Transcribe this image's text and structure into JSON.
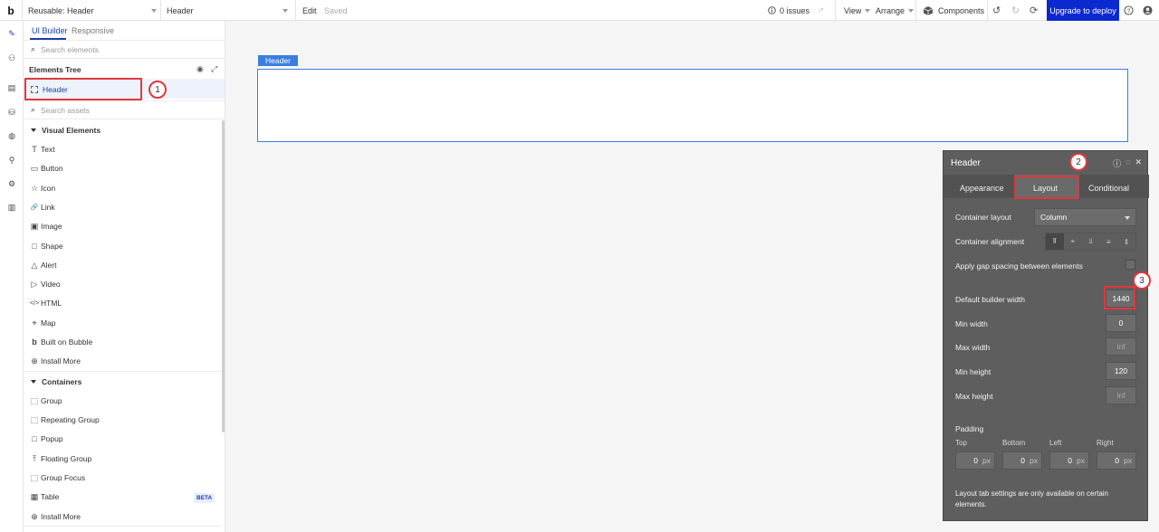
{
  "topbar": {
    "logo": "b",
    "page_selector": "Reusable: Header",
    "element_selector": "Header",
    "edit": "Edit",
    "saved": "Saved",
    "issues": "0 issues",
    "view": "View",
    "arrange": "Arrange",
    "components": "Components",
    "upgrade": "Upgrade to deploy"
  },
  "panel": {
    "tabs": [
      "UI Builder",
      "Responsive"
    ],
    "search_elements": "Search elements",
    "elements_tree": "Elements Tree",
    "tree_item": "Header",
    "search_assets": "Search assets",
    "visual_elements_title": "Visual Elements",
    "visual_elements": [
      {
        "label": "Text",
        "icon": "T"
      },
      {
        "label": "Button",
        "icon": "▭"
      },
      {
        "label": "Icon",
        "icon": "☆"
      },
      {
        "label": "Link",
        "icon": "🔗"
      },
      {
        "label": "Image",
        "icon": "▣"
      },
      {
        "label": "Shape",
        "icon": "□"
      },
      {
        "label": "Alert",
        "icon": "△"
      },
      {
        "label": "Video",
        "icon": "▷"
      },
      {
        "label": "HTML",
        "icon": "</>"
      },
      {
        "label": "Map",
        "icon": "⌖"
      },
      {
        "label": "Built on Bubble",
        "icon": "b"
      },
      {
        "label": "Install More",
        "icon": "⊕"
      }
    ],
    "containers_title": "Containers",
    "containers": [
      {
        "label": "Group",
        "icon": "⬚"
      },
      {
        "label": "Repeating Group",
        "icon": "⬚"
      },
      {
        "label": "Popup",
        "icon": "□"
      },
      {
        "label": "Floating Group",
        "icon": "⤒"
      },
      {
        "label": "Group Focus",
        "icon": "⬚"
      },
      {
        "label": "Table",
        "icon": "▦"
      },
      {
        "label": "Install More",
        "icon": "⊕"
      }
    ],
    "beta": "BETA"
  },
  "canvas": {
    "header_label": "Header"
  },
  "annotations": [
    "1",
    "2",
    "3"
  ],
  "property_editor": {
    "title": "Header",
    "tabs": [
      "Appearance",
      "Layout",
      "Conditional"
    ],
    "container_layout_label": "Container layout",
    "container_layout_value": "Column",
    "container_alignment_label": "Container alignment",
    "gap_label": "Apply gap spacing between elements",
    "fields": [
      {
        "label": "Default builder width",
        "value": "1440"
      },
      {
        "label": "Min width",
        "value": "0"
      },
      {
        "label": "Max width",
        "value": "inf"
      },
      {
        "label": "Min height",
        "value": "120"
      },
      {
        "label": "Max height",
        "value": "inf"
      }
    ],
    "padding_label": "Padding",
    "padding": [
      {
        "label": "Top",
        "value": "0",
        "unit": "px"
      },
      {
        "label": "Bottom",
        "value": "0",
        "unit": "px"
      },
      {
        "label": "Left",
        "value": "0",
        "unit": "px"
      },
      {
        "label": "Right",
        "value": "0",
        "unit": "px"
      }
    ],
    "note": "Layout tab settings are only available on certain elements."
  },
  "colors": {
    "accent": "#1a3fa8",
    "upgrade": "#0c29d0",
    "annotation_red": "#e0383e",
    "canvas_blue": "#3b7ee0"
  }
}
